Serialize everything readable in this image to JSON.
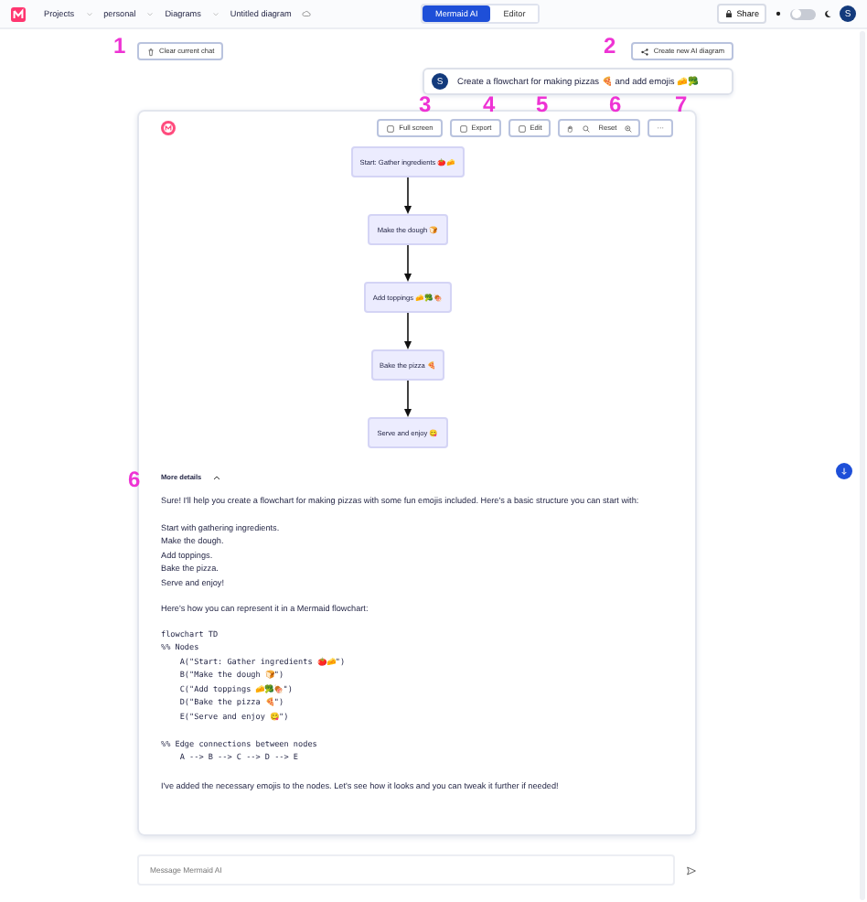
{
  "topbar": {
    "breadcrumbs": [
      "Projects",
      "personal",
      "Diagrams",
      "Untitled diagram"
    ],
    "mode_tabs": [
      {
        "label": "Mermaid AI",
        "selected": true
      },
      {
        "label": "Editor",
        "selected": false
      }
    ],
    "share_button": "Share",
    "dark_mode": false,
    "avatar": "S"
  },
  "chat_actions": {
    "clear": "Clear current chat",
    "create": "Create new AI diagram"
  },
  "user_message": {
    "avatar": "S",
    "text": "Create a flowchart for making pizzas 🍕 and add emojis 🧀🥦"
  },
  "response": {
    "toolbar": [
      "Full screen",
      "Export",
      "Edit"
    ],
    "reset": "Reset",
    "more": "···",
    "nodes": [
      "Start: Gather ingredients 🍅🧀",
      "Make the dough 🍞",
      "Add toppings 🧀🥦🍖",
      "Bake the pizza 🍕",
      "Serve and enjoy 😋"
    ],
    "details": {
      "label": "More details",
      "expanded": true
    },
    "blocks": [
      {
        "kind": "text",
        "lines": [
          "Sure! I'll help you create a flowchart for making pizzas with some fun emojis included. Here's a basic structure you can start with:"
        ]
      },
      {
        "kind": "text",
        "lines": [
          "Start with gathering ingredients.",
          "Make the dough.",
          "Add toppings.",
          "Bake the pizza.",
          "Serve and enjoy!"
        ]
      },
      {
        "kind": "text",
        "lines": [
          "Here's how you can represent it in a Mermaid flowchart:"
        ]
      },
      {
        "kind": "code",
        "lines": [
          "flowchart TD",
          "%% Nodes",
          "    A(\"Start: Gather ingredients 🍅🧀\")",
          "    B(\"Make the dough 🍞\")",
          "    C(\"Add toppings 🧀🥦🍖\")",
          "    D(\"Bake the pizza 🍕\")",
          "    E(\"Serve and enjoy 😋\")"
        ]
      },
      {
        "kind": "code",
        "lines": [
          "%% Edge connections between nodes",
          "    A --> B --> C --> D --> E"
        ]
      },
      {
        "kind": "text",
        "lines": [
          "I've added the necessary emojis to the nodes. Let's see how it looks and you can tweak it further if needed!"
        ]
      }
    ]
  },
  "composer": {
    "placeholder": "Message Mermaid AI"
  },
  "annotations": [
    {
      "label": "1"
    },
    {
      "label": "2"
    },
    {
      "label": "3"
    },
    {
      "label": "4"
    },
    {
      "label": "5"
    },
    {
      "label": "6"
    },
    {
      "label": "7"
    },
    {
      "label": "6"
    }
  ]
}
